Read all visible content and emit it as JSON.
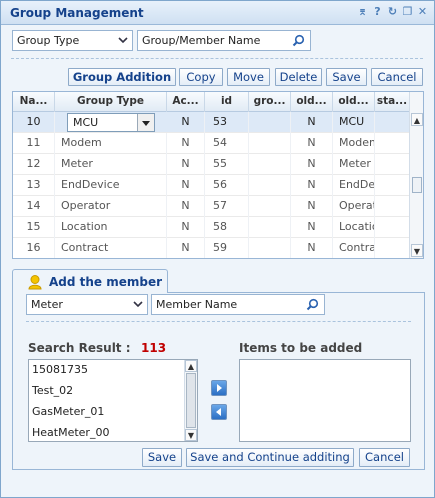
{
  "window": {
    "title": "Group Management"
  },
  "title_tools": [
    "pin-icon",
    "help-icon",
    "refresh-icon",
    "restore-icon",
    "close-icon"
  ],
  "filter": {
    "type_value": "Group Type",
    "name_placeholder": "Group/Member Name"
  },
  "toolbar": {
    "group_addition": "Group Addition",
    "copy": "Copy",
    "move": "Move",
    "delete": "Delete",
    "save": "Save",
    "cancel": "Cancel"
  },
  "grid": {
    "columns": [
      "Na...",
      "Group Type",
      "Ac...",
      "id",
      "gro...",
      "old...",
      "old...",
      "sta..."
    ],
    "rows": [
      {
        "no": "10",
        "type": "MCU",
        "ac": "N",
        "id": "53",
        "gro": "",
        "old1": "N",
        "old2": "MCU",
        "sta": ""
      },
      {
        "no": "11",
        "type": "Modem",
        "ac": "N",
        "id": "54",
        "gro": "",
        "old1": "N",
        "old2": "Modem",
        "sta": ""
      },
      {
        "no": "12",
        "type": "Meter",
        "ac": "N",
        "id": "55",
        "gro": "",
        "old1": "N",
        "old2": "Meter",
        "sta": ""
      },
      {
        "no": "13",
        "type": "EndDevice",
        "ac": "N",
        "id": "56",
        "gro": "",
        "old1": "N",
        "old2": "EndDevice",
        "sta": ""
      },
      {
        "no": "14",
        "type": "Operator",
        "ac": "N",
        "id": "57",
        "gro": "",
        "old1": "N",
        "old2": "Operator",
        "sta": ""
      },
      {
        "no": "15",
        "type": "Location",
        "ac": "N",
        "id": "58",
        "gro": "",
        "old1": "N",
        "old2": "Location",
        "sta": ""
      },
      {
        "no": "16",
        "type": "Contract",
        "ac": "N",
        "id": "59",
        "gro": "",
        "old1": "N",
        "old2": "Contract",
        "sta": ""
      }
    ]
  },
  "member": {
    "tab_label": "Add the member",
    "type_value": "Meter",
    "name_placeholder": "Member Name",
    "search_label": "Search Result :",
    "search_count": "113",
    "added_label": "Items to be added",
    "results": [
      "15081735",
      "Test_02",
      "GasMeter_01",
      "HeatMeter_00"
    ],
    "save": "Save",
    "save_continue": "Save and Continue additing",
    "cancel": "Cancel"
  },
  "colors": {
    "accent": "#15428b",
    "count": "#c00000",
    "selected_row": "#dde9f7"
  }
}
